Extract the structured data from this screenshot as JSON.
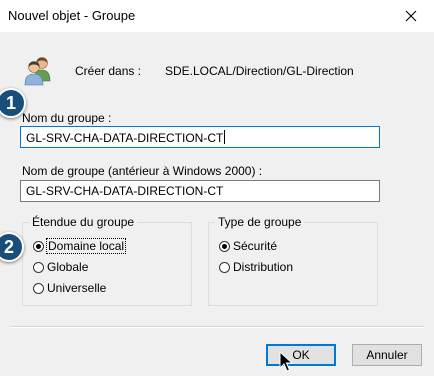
{
  "window": {
    "title": "Nouvel objet - Groupe"
  },
  "create_in": {
    "label": "Créer dans :",
    "path": "SDE.LOCAL/Direction/GL-Direction"
  },
  "markers": {
    "step1": "1",
    "step2": "2"
  },
  "group_name": {
    "label": "Nom du groupe :",
    "value": "GL-SRV-CHA-DATA-DIRECTION-CT"
  },
  "group_name_pre2000": {
    "label": "Nom de groupe (antérieur à Windows 2000) :",
    "value": "GL-SRV-CHA-DATA-DIRECTION-CT"
  },
  "scope": {
    "legend": "Étendue du groupe",
    "options": [
      {
        "label": "Domaine local",
        "selected": true
      },
      {
        "label": "Globale",
        "selected": false
      },
      {
        "label": "Universelle",
        "selected": false
      }
    ]
  },
  "type": {
    "legend": "Type de groupe",
    "options": [
      {
        "label": "Sécurité",
        "selected": true
      },
      {
        "label": "Distribution",
        "selected": false
      }
    ]
  },
  "buttons": {
    "ok": "OK",
    "cancel": "Annuler"
  },
  "icons": {
    "close": "close-icon",
    "group": "users-icon",
    "cursor": "mouse-pointer-icon"
  },
  "colors": {
    "accent": "#0078d7",
    "marker": "#1a4e7a",
    "dialog_bg": "#f0f0f0"
  }
}
